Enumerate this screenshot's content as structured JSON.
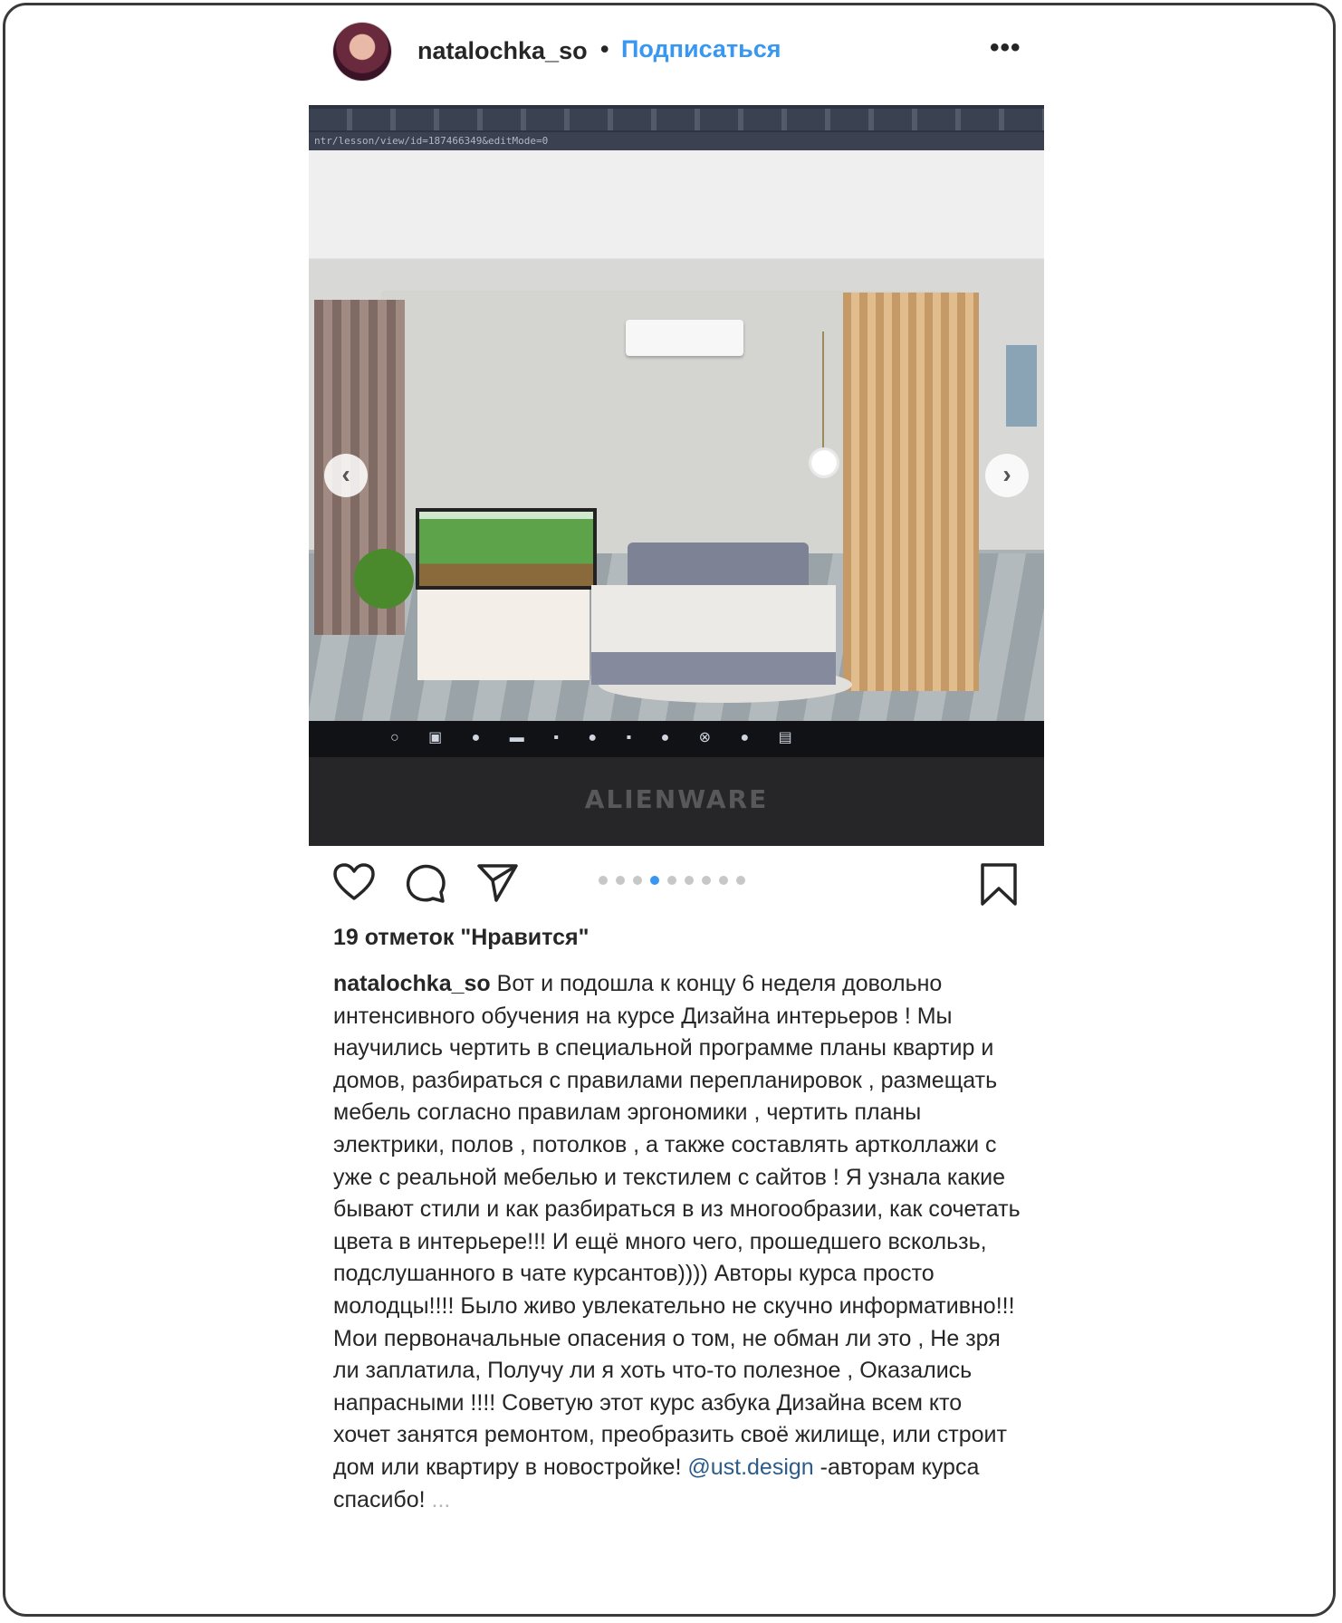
{
  "header": {
    "username": "natalochka_so",
    "separator": "•",
    "follow_label": "Подписаться",
    "more_label": "•••"
  },
  "photo": {
    "url_text": "ntr/lesson/view/id=187466349&editMode=0",
    "brand_text": "ALIENWARE",
    "carousel_total": 9,
    "carousel_active_index": 3
  },
  "actions": {
    "like_icon": "heart-icon",
    "comment_icon": "comment-bubble-icon",
    "share_icon": "paper-plane-icon",
    "save_icon": "bookmark-icon"
  },
  "likes_text": "19 отметок \"Нравится\"",
  "caption": {
    "username": "natalochka_so",
    "text": "Вот и подошла к концу 6 неделя довольно интенсивного обучения на курсе Дизайна интерьеров ! Мы научились чертить в специальной программе планы квартир и домов, разбираться с правилами перепланировок , размещать мебель согласно правилам эргономики , чертить планы электрики, полов , потолков , а также составлять артколлажи с уже с реальной мебелью и текстилем с сайтов ! Я узнала какие бывают стили и как разбираться в из многообразии, как сочетать цвета в интерьере!!! И ещё много чего, прошедшего вскользь, подслушанного в чате курсантов)))) Авторы курса просто молодцы!!!! Было живо увлекательно не скучно информативно!!! Мои первоначальные опасения о том, не обман ли это , Не зря ли заплатила, Получу ли я хоть что-то полезное , Оказались напрасными !!!! Советую этот курс азбука Дизайна всем кто хочет занятся ремонтом, преобразить своё жилище, или строит дом или квартиру в новостройке!",
    "mention": "@ust.design",
    "text_after_mention": " -авторам курса спасибо!",
    "faded_tail": "..."
  },
  "colors": {
    "link_blue": "#3897f0",
    "mention_blue": "#2b5c8a",
    "text": "#262626"
  }
}
